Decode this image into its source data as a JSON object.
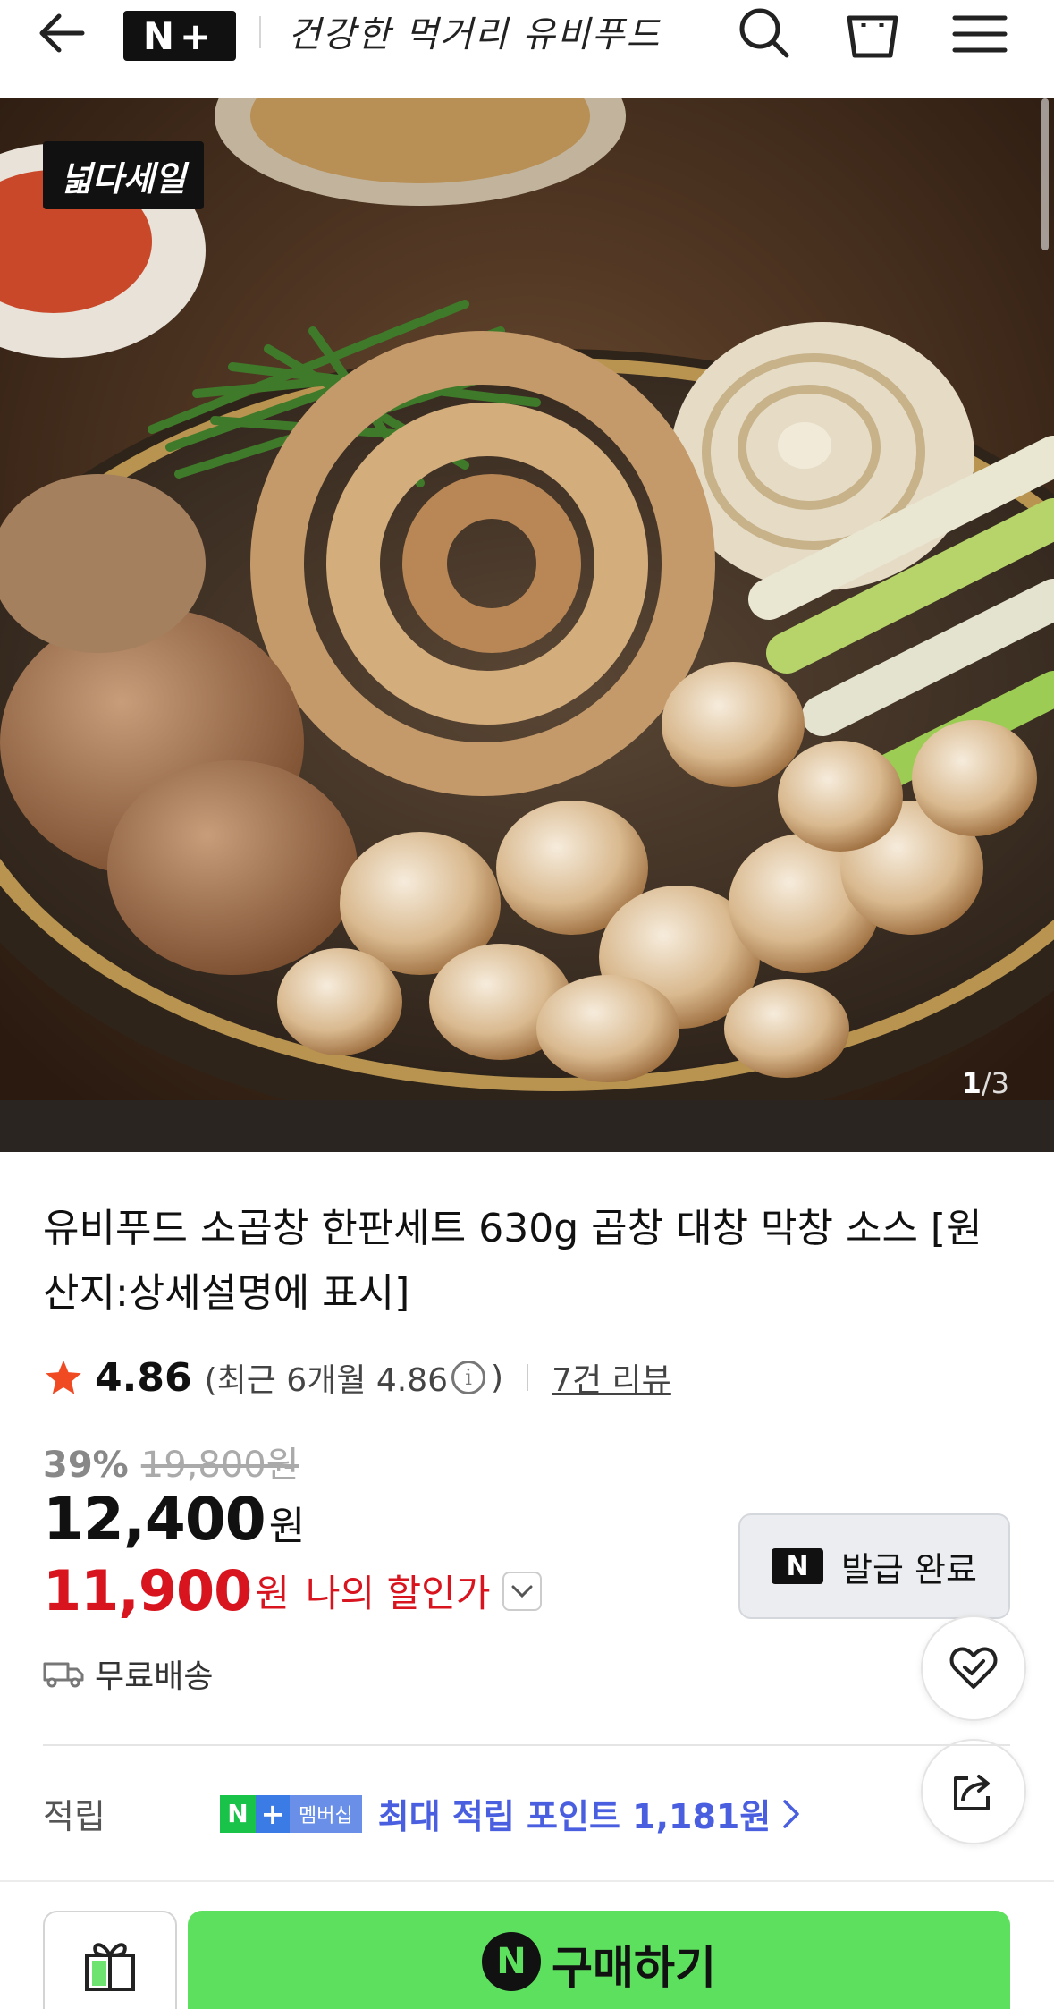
{
  "header": {
    "logo": "N+",
    "store_name": "건강한 먹거리 유비푸드",
    "icons": [
      "back-arrow-icon",
      "search-icon",
      "cart-icon",
      "menu-icon"
    ]
  },
  "hero": {
    "badge": "넓다세일",
    "current_page": "1",
    "page_separator": "/",
    "total_pages": "3"
  },
  "product": {
    "title": "유비푸드 소곱창 한판세트 630g 곱창 대창 막창 소스 [원산지:상세설명에 표시]",
    "rating": "4.86",
    "recent_rating_prefix": "(최근 6개월 4.86",
    "recent_rating_suffix": ")",
    "review_link": "7건 리뷰",
    "discount_rate": "39%",
    "original_price": "19,800원",
    "price": "12,400",
    "price_unit": "원",
    "my_price": "11,900",
    "my_price_unit": "원",
    "my_price_label": "나의 할인가",
    "shipping": "무료배송"
  },
  "coupon": {
    "label": "발급 완료",
    "icon_text": "N"
  },
  "points": {
    "label": "적립",
    "badge_n": "N",
    "badge_plus": "+",
    "badge_member": "멤버십",
    "text": "최대 적립 포인트 1,181원"
  },
  "bottom": {
    "buy_label": "구매하기",
    "buy_icon_text": "N"
  },
  "colors": {
    "accent_red": "#d8141e",
    "buy_green": "#5ee05f",
    "points_blue": "#4a5ee0",
    "star": "#f04a23"
  }
}
